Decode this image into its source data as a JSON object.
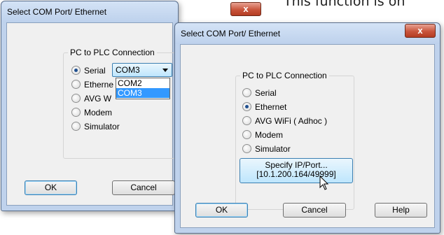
{
  "background_text": "This function is on",
  "dialog_back": {
    "title": "Select  COM Port/ Ethernet",
    "close_glyph": "x",
    "group_label": "PC to PLC Connection",
    "options": [
      {
        "label": "Serial",
        "checked": true
      },
      {
        "label": "Etherne",
        "checked": false
      },
      {
        "label": "AVG W",
        "checked": false
      },
      {
        "label": "Modem",
        "checked": false
      },
      {
        "label": "Simulator",
        "checked": false
      }
    ],
    "combo_value": "COM3",
    "dropdown_options": [
      "COM2",
      "COM3"
    ],
    "dropdown_selected": "COM3",
    "ok_label": "OK",
    "cancel_label": "Cancel"
  },
  "dialog_front": {
    "title": "Select  COM Port/ Ethernet",
    "close_glyph": "x",
    "group_label": "PC to PLC Connection",
    "options": [
      {
        "label": "Serial",
        "checked": false
      },
      {
        "label": "Ethernet",
        "checked": true
      },
      {
        "label": "AVG WiFi ( Adhoc )",
        "checked": false
      },
      {
        "label": "Modem",
        "checked": false
      },
      {
        "label": "Simulator",
        "checked": false
      }
    ],
    "specify_line1": "Specify IP/Port...",
    "specify_line2": "[10.1.200.164/49999]",
    "ok_label": "OK",
    "cancel_label": "Cancel",
    "help_label": "Help"
  },
  "colors": {
    "window_frame": "#bfd2ec",
    "close_button": "#c9553c",
    "selection": "#3399ff",
    "focus_border": "#3c7fb1"
  }
}
